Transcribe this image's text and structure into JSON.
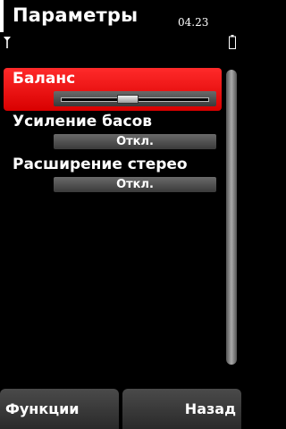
{
  "status": {
    "title": "Параметры",
    "time": "04.23"
  },
  "settings": [
    {
      "label": "Баланс",
      "type": "slider",
      "value": 0.45,
      "selected": true
    },
    {
      "label": "Усиление басов",
      "type": "select",
      "value": "Откл.",
      "selected": false
    },
    {
      "label": "Расширение стерео",
      "type": "select",
      "value": "Откл.",
      "selected": false
    }
  ],
  "softkeys": {
    "left": "Функции",
    "right": "Назад"
  },
  "colors": {
    "accent": "#e80000",
    "background": "#000000"
  }
}
